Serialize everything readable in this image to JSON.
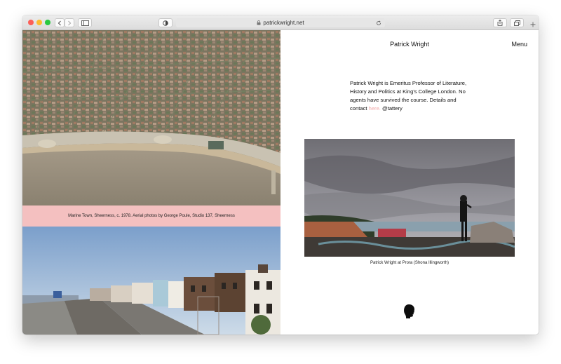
{
  "browser": {
    "url": "patrickwright.net",
    "lock_icon": "lock-icon",
    "reload_icon": "reload-icon"
  },
  "site": {
    "title": "Patrick Wright",
    "menu_label": "Menu"
  },
  "bio": {
    "text_before_link": "Patrick Wright is  Emeritus Professor of Literature, History and Politics at King's College London. No agents have survived the course.  Details and contact ",
    "link_text": "here.",
    "after_link": " @tattery"
  },
  "images": {
    "aerial_caption": "Marine Town, Sheerness, c. 1978. Aerial photos by George Poule, Studio 137, Sheerness",
    "portrait_caption": "Patrick Wright at Prora (Shona Illingworth)"
  },
  "colors": {
    "caption_band": "#f4c0c0",
    "link": "#f0aaaa"
  }
}
